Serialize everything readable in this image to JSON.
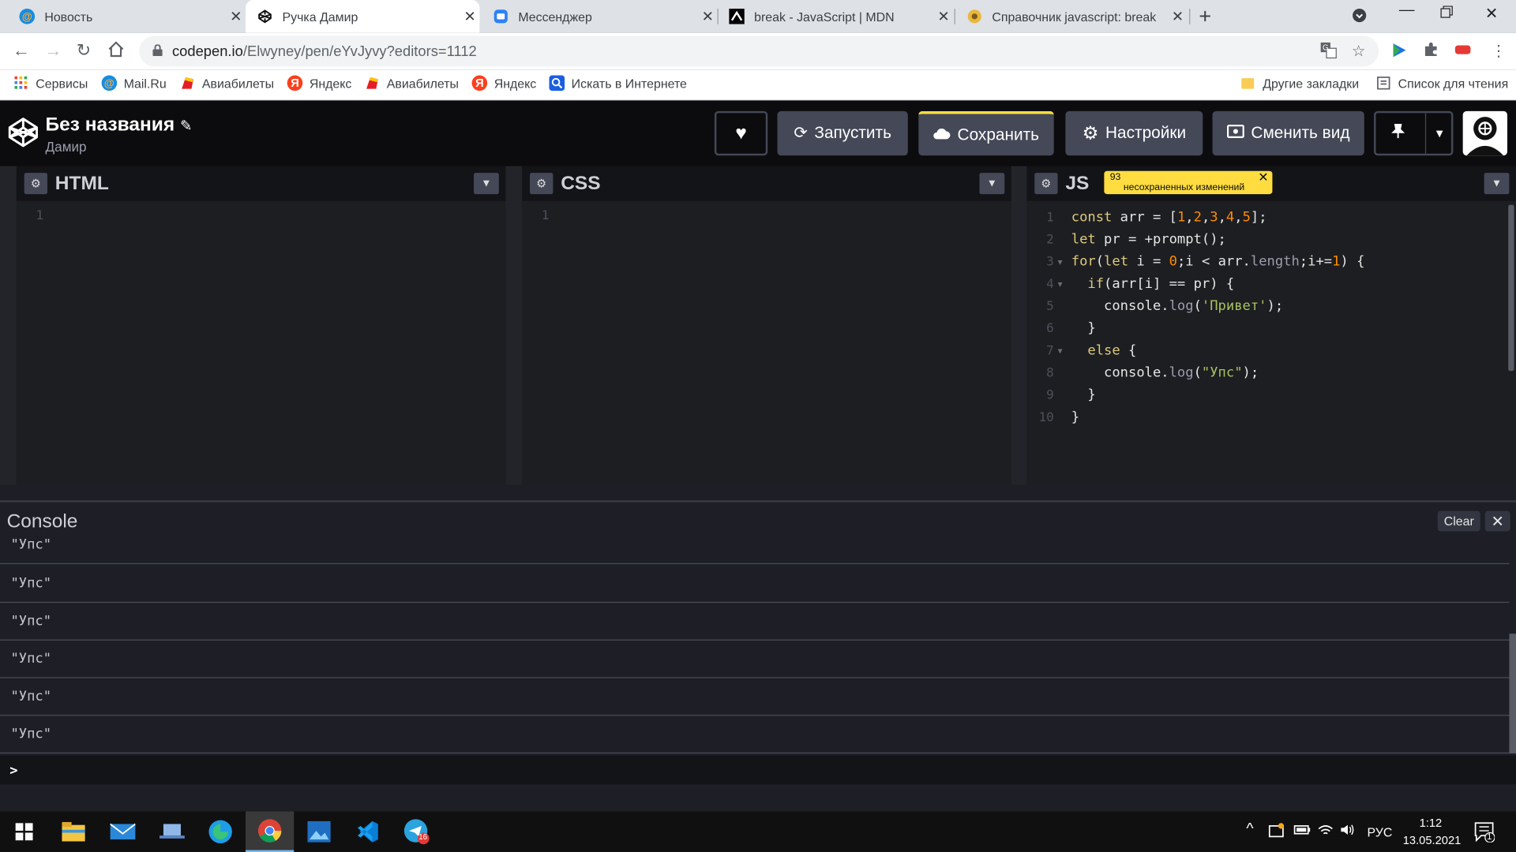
{
  "browser": {
    "tabs": [
      {
        "title": "Новость",
        "icon": "mail-ru-icon"
      },
      {
        "title": "Ручка Дамир",
        "icon": "codepen-icon",
        "active": true
      },
      {
        "title": "Мессенджер",
        "icon": "messenger-icon"
      },
      {
        "title": "break - JavaScript | MDN",
        "icon": "mdn-icon"
      },
      {
        "title": "Справочник javascript: break",
        "icon": "javascript-ru-icon"
      }
    ],
    "url": "codepen.io/Elwyney/pen/eYvJyvy?editors=1112",
    "url_host": "codepen.io",
    "url_path": "/Elwyney/pen/eYvJyvy?editors=1112",
    "bookmarks": [
      {
        "label": "Сервисы",
        "icon": "apps-grid-icon"
      },
      {
        "label": "Mail.Ru",
        "icon": "mail-ru-icon"
      },
      {
        "label": "Авиабилеты",
        "icon": "tickets-icon"
      },
      {
        "label": "Яндекс",
        "icon": "yandex-icon"
      },
      {
        "label": "Авиабилеты",
        "icon": "tickets-icon"
      },
      {
        "label": "Яндекс",
        "icon": "yandex-icon"
      },
      {
        "label": "Искать в Интернете",
        "icon": "search-icon"
      }
    ],
    "other_bookmarks": "Другие закладки",
    "reading_list": "Список для чтения"
  },
  "codepen": {
    "title": "Без названия",
    "user": "Дамир",
    "buttons": {
      "run": "Запустить",
      "save": "Сохранить",
      "settings": "Настройки",
      "view": "Сменить вид"
    },
    "panels": {
      "html": "HTML",
      "css": "CSS",
      "js": "JS"
    },
    "unsaved": {
      "count": "93",
      "text": "несохраненных изменений"
    },
    "empty_line": "1",
    "js_code": [
      "const arr = [1,2,3,4,5];",
      "let pr = +prompt();",
      "for(let i = 0;i < arr.length;i+=1) {",
      "  if(arr[i] == pr) {",
      "    console.log('Привет');",
      "  }",
      "  else {",
      "    console.log(\"Упс\");",
      "  }",
      "}"
    ],
    "line_numbers": [
      "1",
      "2",
      "3",
      "4",
      "5",
      "6",
      "7",
      "8",
      "9",
      "10"
    ]
  },
  "console": {
    "title": "Console",
    "clear": "Clear",
    "entries": [
      "\"Упс\"",
      "\"Упс\"",
      "\"Упс\"",
      "\"Упс\"",
      "\"Упс\"",
      "\"Упс\""
    ],
    "prompt": ">"
  },
  "taskbar": {
    "lang": "РУС",
    "time": "1:12",
    "date": "13.05.2021",
    "telegram_badge": "16",
    "notifications": "1"
  }
}
